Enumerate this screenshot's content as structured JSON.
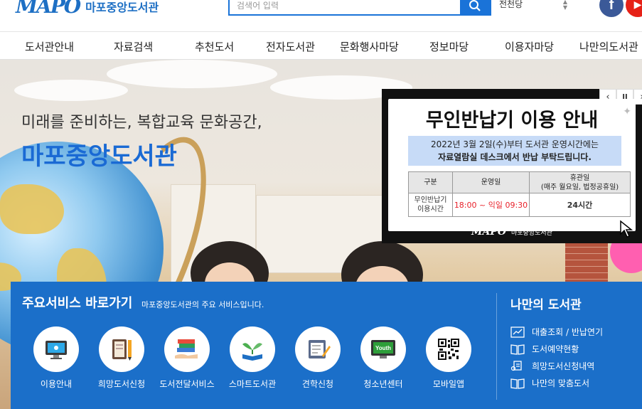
{
  "header": {
    "logo_mark": "MAPO",
    "logo_text": "마포중앙도서관",
    "search_placeholder": "검색어 입력",
    "region_selected": "전천당",
    "sns": [
      "facebook-icon",
      "youtube-icon"
    ]
  },
  "nav": {
    "items": [
      {
        "label": "도서관안내"
      },
      {
        "label": "자료검색"
      },
      {
        "label": "추천도서"
      },
      {
        "label": "전자도서관"
      },
      {
        "label": "문화행사마당"
      },
      {
        "label": "정보마당"
      },
      {
        "label": "이용자마당"
      },
      {
        "label": "나만의도서관"
      }
    ]
  },
  "hero": {
    "subtitle": "미래를 준비하는, 복합교육 문화공간,",
    "title": "마포중앙도서관"
  },
  "popup": {
    "title": "무인반납기 이용 안내",
    "note_line1": "2022년 3월 2일(수)부터 도서관 운영시간에는",
    "note_line2": "자료열람실 데스크에서 반납 부탁드립니다.",
    "table": {
      "col1": "구분",
      "col2": "운영일",
      "col3_line1": "휴관일",
      "col3_line2": "(매주 월요일, 법정공휴일)",
      "row_label_line1": "무인반납기",
      "row_label_line2": "이용시간",
      "operating": "18:00 ~ 익일 09:30",
      "closed": "24시간"
    },
    "footer_mark": "MAPO",
    "footer_text": "마포중앙도서관",
    "controls": [
      "‹",
      "II",
      "›"
    ],
    "accent_color": "#e8212a"
  },
  "services": {
    "title": "주요서비스 바로가기",
    "subtitle": "마포중앙도서관의 주요 서비스입니다.",
    "items": [
      {
        "label": "이용안내",
        "icon": "monitor-icon"
      },
      {
        "label": "희망도서신청",
        "icon": "book-pencil-icon"
      },
      {
        "label": "도서전달서비스",
        "icon": "books-hand-icon"
      },
      {
        "label": "스마트도서관",
        "icon": "sprout-book-icon"
      },
      {
        "label": "견학신청",
        "icon": "document-pen-icon"
      },
      {
        "label": "청소년센터",
        "icon": "youth-screen-icon"
      },
      {
        "label": "모바일앱",
        "icon": "qr-code-icon"
      }
    ],
    "youth_badge": "Youth"
  },
  "my_library": {
    "title": "나만의 도서관",
    "items": [
      {
        "label": "대출조회 / 반납연기",
        "icon": "chart-icon"
      },
      {
        "label": "도서예약현황",
        "icon": "open-book-icon"
      },
      {
        "label": "희망도서신청내역",
        "icon": "request-icon"
      },
      {
        "label": "나만의 맞춤도서",
        "icon": "open-book-icon"
      }
    ]
  }
}
